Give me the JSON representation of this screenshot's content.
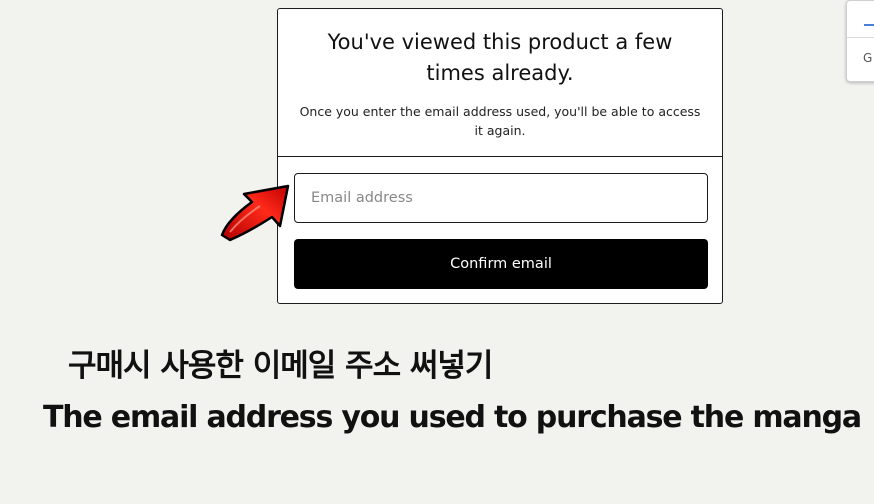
{
  "modal": {
    "title": "You've viewed this product a few times already.",
    "description": "Once you enter the email address used, you'll be able to access it again.",
    "email_placeholder": "Email address",
    "email_value": "",
    "confirm_label": "Confirm email"
  },
  "annotation": {
    "arrow_icon": "red-arrow-icon",
    "arrow_color": "#e01010",
    "caption_korean": "구매시 사용한 이메일 주소 써넣기",
    "caption_english": "The email address you used to purchase the manga"
  },
  "side_widget": {
    "letter": "G"
  },
  "colors": {
    "background": "#f2f2ef",
    "button": "#000000",
    "border": "#1c1c1c"
  }
}
